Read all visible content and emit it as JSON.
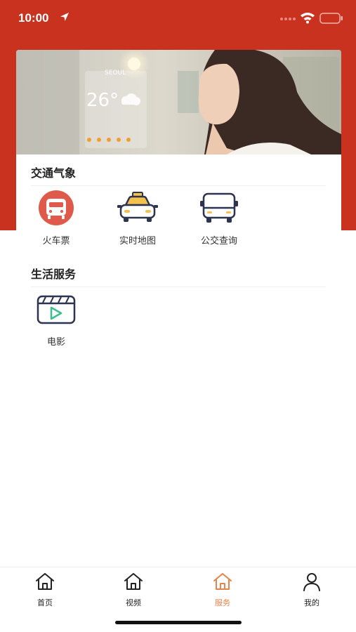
{
  "status": {
    "time": "10:00"
  },
  "colors": {
    "header_red": "#c9321f",
    "active_tab": "#e8844a",
    "icon_navy": "#2d3450",
    "train_red": "#e05a4c",
    "taxi_yellow": "#f2c14e",
    "play_green": "#3cc08a"
  },
  "banner": {
    "city": "SEOUL",
    "temperature": "26°"
  },
  "sections": [
    {
      "title": "交通气象",
      "items": [
        {
          "label": "火车票",
          "icon": "train-icon"
        },
        {
          "label": "实时地图",
          "icon": "taxi-icon"
        },
        {
          "label": "公交查询",
          "icon": "bus-icon"
        }
      ]
    },
    {
      "title": "生活服务",
      "items": [
        {
          "label": "电影",
          "icon": "movie-clapper-icon"
        }
      ]
    }
  ],
  "tabs": [
    {
      "label": "首页",
      "icon": "home-icon",
      "active": false
    },
    {
      "label": "视频",
      "icon": "home-icon",
      "active": false
    },
    {
      "label": "服务",
      "icon": "home-icon",
      "active": true
    },
    {
      "label": "我的",
      "icon": "user-icon",
      "active": false
    }
  ]
}
